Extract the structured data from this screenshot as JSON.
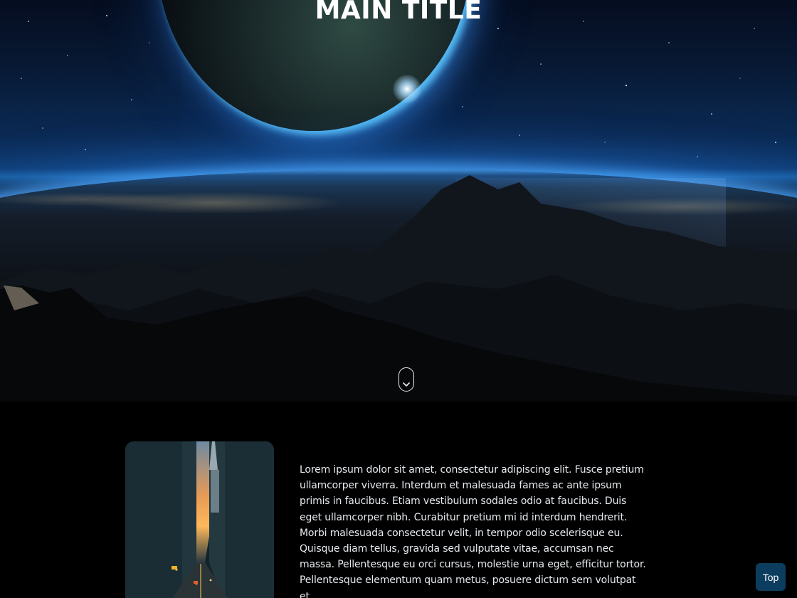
{
  "hero": {
    "title": "MAIN TITLE",
    "background_image": "earth-from-space",
    "scroll_icon": "chevron-down-icon"
  },
  "content": {
    "image": "city-street-at-sunset",
    "paragraph": "Lorem ipsum dolor sit amet, consectetur adipiscing elit. Fusce pretium ullamcorper viverra. Interdum et malesuada fames ac ante ipsum primis in faucibus. Etiam vestibulum sodales odio at faucibus. Duis eget ullamcorper nibh. Curabitur pretium mi id interdum hendrerit. Morbi malesuada consectetur velit, in tempor odio scelerisque eu. Quisque diam tellus, gravida sed vulputate vitae, accumsan nec massa. Pellentesque eu orci cursus, molestie urna eget, efficitur tortor. Pellentesque elementum quam metus, posuere dictum sem volutpat et."
  },
  "top_button": {
    "label": "Top"
  },
  "colors": {
    "page_background": "#000000",
    "text": "#e6eaee",
    "top_button": "#0c3d5e"
  }
}
